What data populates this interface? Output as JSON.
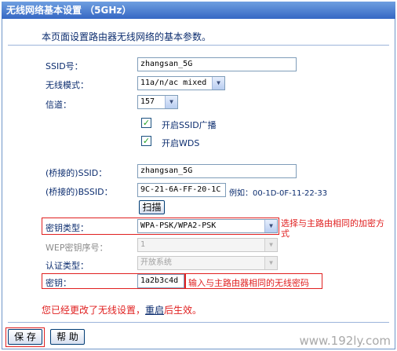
{
  "title": "无线网络基本设置 （5GHz）",
  "description": "本页面设置路由器无线网络的基本参数。",
  "ssid": {
    "label": "SSID号：",
    "value": "zhangsan_5G"
  },
  "mode": {
    "label": "无线模式：",
    "value": "11a/n/ac mixed"
  },
  "channel": {
    "label": "信道：",
    "value": "157"
  },
  "broadcast": {
    "label": "开启SSID广播",
    "checked": true
  },
  "wds": {
    "label": "开启WDS",
    "checked": true
  },
  "bridged_ssid": {
    "label": "(桥接的)SSID：",
    "value": "zhangsan_5G"
  },
  "bridged_bssid": {
    "label": "(桥接的)BSSID：",
    "value": "9C-21-6A-FF-20-1C",
    "example": "例如：00-1D-0F-11-22-33"
  },
  "scan_button": "扫描",
  "key_type": {
    "label": "密钥类型：",
    "value": "WPA-PSK/WPA2-PSK",
    "note": "选择与主路由相同的加密方式"
  },
  "wep_index": {
    "label": "WEP密钥序号：",
    "value": "1"
  },
  "auth_type": {
    "label": "认证类型：",
    "value": "开放系统"
  },
  "key": {
    "label": "密钥：",
    "value": "1a2b3c4d",
    "note": "输入与主路由器相同的无线密码"
  },
  "warning": {
    "before": "您已经更改了无线设置，",
    "link": "重启",
    "after": "后生效。"
  },
  "buttons": {
    "save": "保 存",
    "help": "帮 助"
  },
  "watermark": "www.192ly.com"
}
